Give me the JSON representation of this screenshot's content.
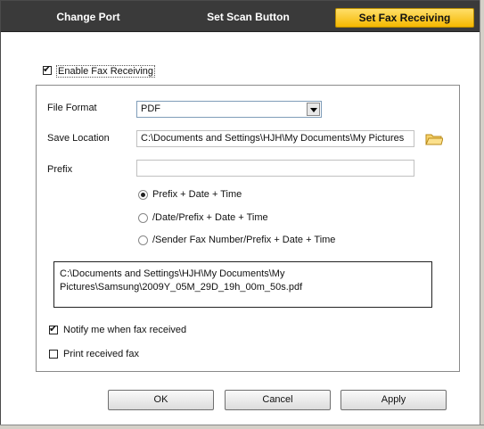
{
  "tabs": [
    {
      "label": "Change Port",
      "active": false
    },
    {
      "label": "Set Scan Button",
      "active": false
    },
    {
      "label": "Set Fax Receiving",
      "active": true
    }
  ],
  "enable_fax": {
    "label": "Enable Fax Receiving",
    "checked": true
  },
  "file_format": {
    "label": "File Format",
    "value": "PDF"
  },
  "save_location": {
    "label": "Save Location",
    "value": "C:\\Documents and Settings\\HJH\\My Documents\\My Pictures"
  },
  "prefix": {
    "label": "Prefix",
    "value": ""
  },
  "naming_options": [
    {
      "label": "Prefix + Date + Time",
      "selected": true
    },
    {
      "label": "/Date/Prefix + Date + Time",
      "selected": false
    },
    {
      "label": "/Sender Fax Number/Prefix + Date + Time",
      "selected": false
    }
  ],
  "path_preview": {
    "line1": "C:\\Documents and Settings\\HJH\\My Documents\\My",
    "line2": "Pictures\\Samsung\\2009Y_05M_29D_19h_00m_50s.pdf"
  },
  "notify": {
    "label": "Notify me when fax received",
    "checked": true
  },
  "print_fax": {
    "label": "Print received fax",
    "checked": false
  },
  "buttons": {
    "ok": "OK",
    "cancel": "Cancel",
    "apply": "Apply"
  },
  "colors": {
    "tab_bar": "#3a3a3a",
    "active_tab": "#f5b800",
    "field_border": "#7f9db9"
  },
  "icons": {
    "browse": "folder-icon"
  }
}
